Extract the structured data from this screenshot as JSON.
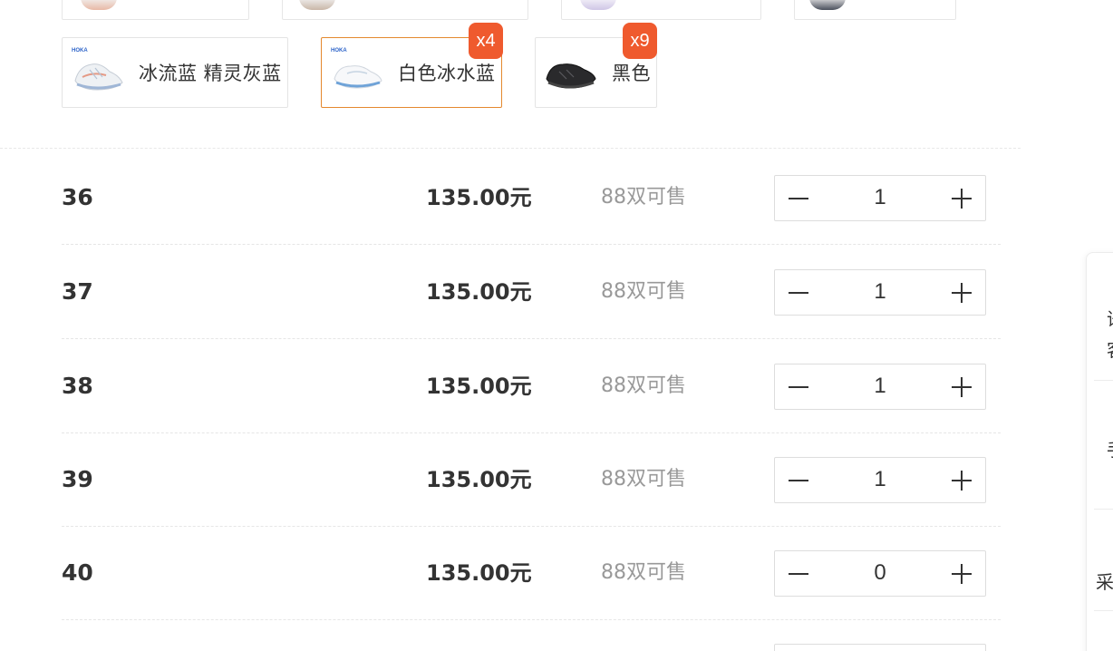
{
  "colors": [
    {
      "label": "冰流蓝 精灵灰蓝",
      "badge": null,
      "selected": false
    },
    {
      "label": "白色冰水蓝",
      "badge": "x4",
      "selected": true
    },
    {
      "label": "黑色",
      "badge": "x9",
      "selected": false
    }
  ],
  "brand_mark": "HOKA",
  "sizes": [
    {
      "size": "36",
      "price": "135.00元",
      "stock": "88双可售",
      "qty": "1"
    },
    {
      "size": "37",
      "price": "135.00元",
      "stock": "88双可售",
      "qty": "1"
    },
    {
      "size": "38",
      "price": "135.00元",
      "stock": "88双可售",
      "qty": "1"
    },
    {
      "size": "39",
      "price": "135.00元",
      "stock": "88双可售",
      "qty": "1"
    },
    {
      "size": "40",
      "price": "135.00元",
      "stock": "88双可售",
      "qty": "0"
    }
  ],
  "side_panel": {
    "partial_text": [
      "语",
      "客",
      "手",
      "采"
    ]
  },
  "theme": {
    "selected_border": "#e4892f",
    "badge_bg": "#ef5a2e",
    "stock_text": "#999999"
  }
}
